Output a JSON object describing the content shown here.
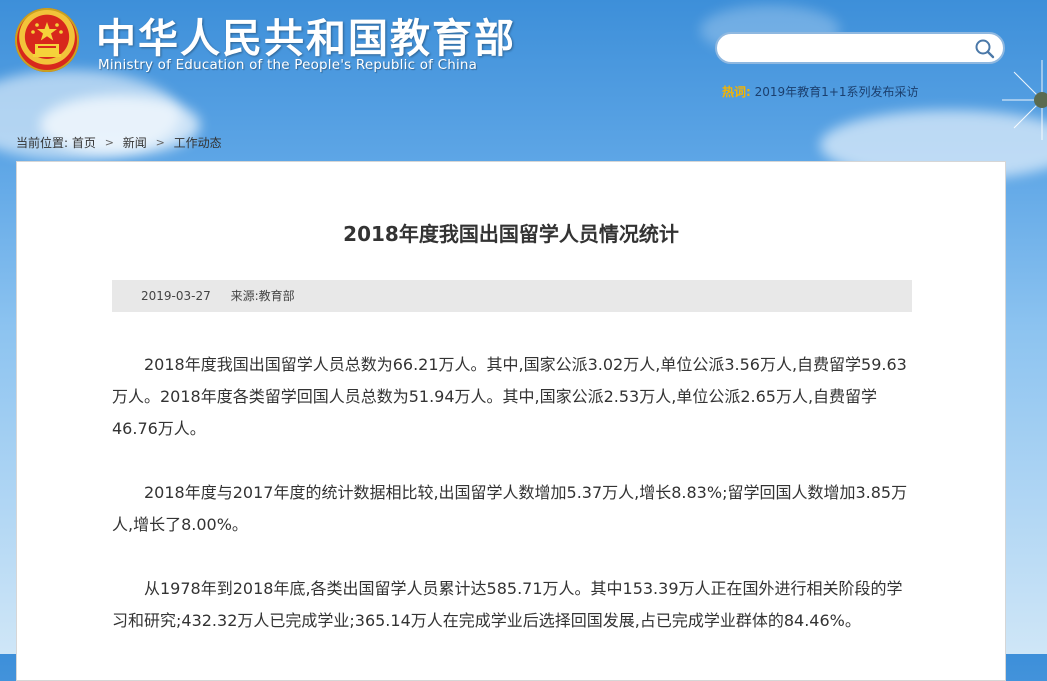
{
  "header": {
    "title_cn": "中华人民共和国教育部",
    "title_en": "Ministry of Education of the People's Republic of China",
    "search": {
      "placeholder": ""
    },
    "hot": {
      "label": "热词:",
      "link": "2019年教育1+1系列发布采访"
    }
  },
  "breadcrumb": {
    "prefix": "当前位置:",
    "items": [
      "首页",
      "新闻",
      "工作动态"
    ]
  },
  "article": {
    "title": "2018年度我国出国留学人员情况统计",
    "date": "2019-03-27",
    "source": "来源:教育部",
    "paragraphs": [
      "2018年度我国出国留学人员总数为66.21万人。其中,国家公派3.02万人,单位公派3.56万人,自费留学59.63万人。2018年度各类留学回国人员总数为51.94万人。其中,国家公派2.53万人,单位公派2.65万人,自费留学46.76万人。",
      "2018年度与2017年度的统计数据相比较,出国留学人数增加5.37万人,增长8.83%;留学回国人数增加3.85万人,增长了8.00%。",
      "从1978年到2018年底,各类出国留学人员累计达585.71万人。其中153.39万人正在国外进行相关阶段的学习和研究;432.32万人已完成学业;365.14万人在完成学业后选择回国发展,占已完成学业群体的84.46%。"
    ]
  },
  "colors": {
    "accent": "#f5b400",
    "link": "#1b3f6e"
  }
}
